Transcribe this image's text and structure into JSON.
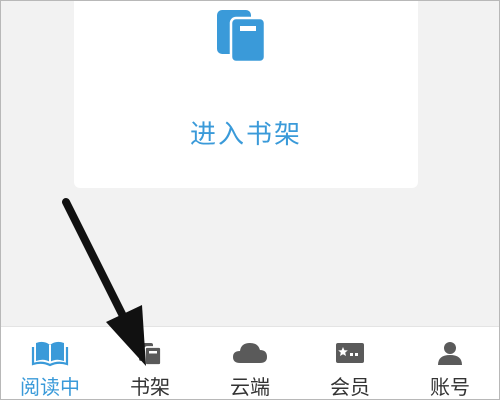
{
  "colors": {
    "accent": "#3a9ad9",
    "icon_grey": "#5a5a5a",
    "background": "#f2f2f2"
  },
  "shelf_card": {
    "icon": "books-icon",
    "label": "进入书架"
  },
  "tabbar": {
    "active_index": 0,
    "tabs": [
      {
        "label": "阅读中",
        "icon": "open-book-icon"
      },
      {
        "label": "书架",
        "icon": "bookshelf-icon"
      },
      {
        "label": "云端",
        "icon": "cloud-icon"
      },
      {
        "label": "会员",
        "icon": "member-card-icon"
      },
      {
        "label": "账号",
        "icon": "account-icon"
      }
    ]
  },
  "annotation": {
    "icon": "black-arrow-pointing-to-bookshelf-tab"
  }
}
